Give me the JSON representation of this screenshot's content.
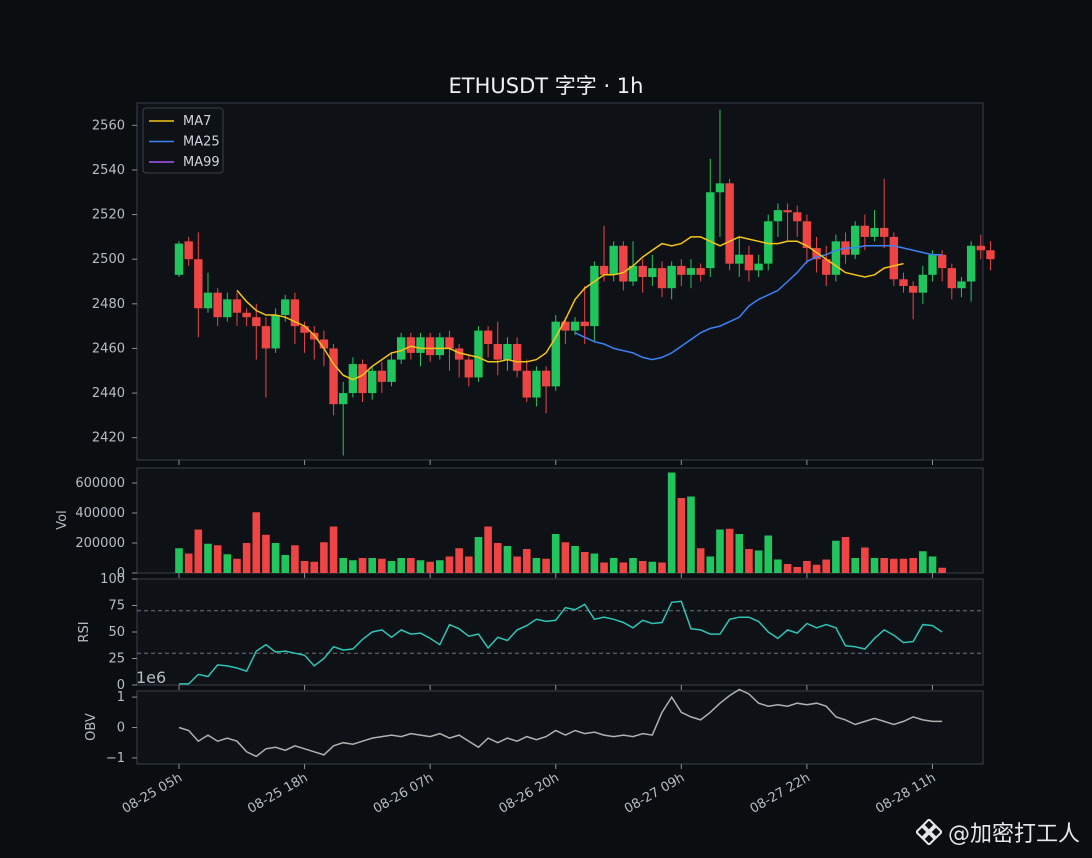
{
  "title": "ETHUSDT 字字 · 1h",
  "watermark": "@加密打工人",
  "colors": {
    "background": "#0b0e11",
    "up": "#21c55d",
    "down": "#ef4444",
    "ma7": "#f5c518",
    "ma25": "#3b82f6",
    "ma99": "#a855f7",
    "rsi": "#2ec4b6",
    "obv": "#b0b0b0"
  },
  "chart_data": [
    {
      "type": "candlestick",
      "title": "ETHUSDT 字字 · 1h",
      "ylim": [
        2410,
        2570
      ],
      "yticks": [
        2420,
        2440,
        2460,
        2480,
        2500,
        2520,
        2540,
        2560
      ],
      "legend": {
        "placement": "top-left",
        "entries": [
          "MA7",
          "MA25",
          "MA99"
        ]
      },
      "x_ticks": [
        "08-25 05h",
        "08-25 18h",
        "08-26 07h",
        "08-26 20h",
        "08-27 09h",
        "08-27 22h",
        "08-28 11h"
      ],
      "ohlc": [
        [
          2493,
          2507,
          2492,
          2508
        ],
        [
          2508,
          2500,
          2497,
          2510
        ],
        [
          2500,
          2478,
          2465,
          2512
        ],
        [
          2478,
          2485,
          2476,
          2494
        ],
        [
          2485,
          2474,
          2470,
          2487
        ],
        [
          2474,
          2482,
          2472,
          2485
        ],
        [
          2482,
          2476,
          2470,
          2485
        ],
        [
          2476,
          2474,
          2470,
          2478
        ],
        [
          2474,
          2470,
          2455,
          2480
        ],
        [
          2470,
          2460,
          2438,
          2474
        ],
        [
          2460,
          2475,
          2458,
          2478
        ],
        [
          2475,
          2482,
          2472,
          2484
        ],
        [
          2482,
          2470,
          2462,
          2485
        ],
        [
          2470,
          2467,
          2458,
          2472
        ],
        [
          2467,
          2464,
          2455,
          2470
        ],
        [
          2464,
          2460,
          2452,
          2468
        ],
        [
          2460,
          2435,
          2430,
          2462
        ],
        [
          2435,
          2440,
          2412,
          2445
        ],
        [
          2440,
          2453,
          2438,
          2456
        ],
        [
          2453,
          2440,
          2436,
          2455
        ],
        [
          2440,
          2450,
          2437,
          2452
        ],
        [
          2450,
          2445,
          2440,
          2454
        ],
        [
          2445,
          2455,
          2443,
          2458
        ],
        [
          2455,
          2465,
          2453,
          2467
        ],
        [
          2465,
          2458,
          2455,
          2467
        ],
        [
          2458,
          2465,
          2452,
          2467
        ],
        [
          2465,
          2457,
          2454,
          2467
        ],
        [
          2457,
          2465,
          2455,
          2467
        ],
        [
          2465,
          2460,
          2450,
          2468
        ],
        [
          2460,
          2455,
          2447,
          2462
        ],
        [
          2455,
          2447,
          2443,
          2457
        ],
        [
          2447,
          2468,
          2445,
          2470
        ],
        [
          2468,
          2462,
          2456,
          2470
        ],
        [
          2462,
          2455,
          2448,
          2472
        ],
        [
          2455,
          2462,
          2450,
          2465
        ],
        [
          2462,
          2450,
          2447,
          2465
        ],
        [
          2450,
          2438,
          2436,
          2455
        ],
        [
          2438,
          2450,
          2434,
          2452
        ],
        [
          2450,
          2443,
          2431,
          2452
        ],
        [
          2443,
          2472,
          2441,
          2475
        ],
        [
          2472,
          2468,
          2462,
          2474
        ],
        [
          2468,
          2472,
          2466,
          2474
        ],
        [
          2472,
          2470,
          2462,
          2488
        ],
        [
          2470,
          2497,
          2463,
          2499
        ],
        [
          2497,
          2493,
          2490,
          2515
        ],
        [
          2493,
          2506,
          2490,
          2508
        ],
        [
          2506,
          2490,
          2486,
          2508
        ],
        [
          2490,
          2497,
          2488,
          2508
        ],
        [
          2497,
          2492,
          2485,
          2500
        ],
        [
          2492,
          2496,
          2488,
          2502
        ],
        [
          2496,
          2487,
          2483,
          2499
        ],
        [
          2487,
          2497,
          2482,
          2499
        ],
        [
          2497,
          2493,
          2488,
          2500
        ],
        [
          2493,
          2496,
          2487,
          2500
        ],
        [
          2496,
          2493,
          2490,
          2498
        ],
        [
          2496,
          2530,
          2492,
          2545
        ],
        [
          2530,
          2534,
          2510,
          2567
        ],
        [
          2534,
          2498,
          2495,
          2536
        ],
        [
          2498,
          2502,
          2492,
          2510
        ],
        [
          2502,
          2495,
          2490,
          2506
        ],
        [
          2495,
          2498,
          2492,
          2502
        ],
        [
          2498,
          2517,
          2495,
          2520
        ],
        [
          2517,
          2522,
          2510,
          2525
        ],
        [
          2522,
          2521,
          2508,
          2525
        ],
        [
          2521,
          2517,
          2510,
          2524
        ],
        [
          2517,
          2505,
          2498,
          2520
        ],
        [
          2505,
          2500,
          2494,
          2510
        ],
        [
          2500,
          2493,
          2488,
          2506
        ],
        [
          2493,
          2508,
          2490,
          2511
        ],
        [
          2508,
          2502,
          2498,
          2512
        ],
        [
          2502,
          2515,
          2500,
          2517
        ],
        [
          2515,
          2510,
          2504,
          2520
        ],
        [
          2510,
          2514,
          2508,
          2522
        ],
        [
          2514,
          2510,
          2505,
          2536
        ],
        [
          2510,
          2491,
          2488,
          2512
        ],
        [
          2491,
          2488,
          2485,
          2494
        ],
        [
          2488,
          2485,
          2473,
          2490
        ],
        [
          2485,
          2493,
          2480,
          2497
        ],
        [
          2493,
          2502,
          2490,
          2504
        ],
        [
          2502,
          2496,
          2490,
          2504
        ],
        [
          2496,
          2487,
          2482,
          2498
        ],
        [
          2487,
          2490,
          2483,
          2492
        ],
        [
          2490,
          2506,
          2481,
          2508
        ],
        [
          2506,
          2504,
          2500,
          2511
        ],
        [
          2504,
          2500,
          2495,
          2508
        ]
      ],
      "ma7": [
        null,
        null,
        null,
        null,
        null,
        null,
        2486,
        2481,
        2477,
        2475,
        2475,
        2474,
        2472,
        2470,
        2466,
        2460,
        2453,
        2448,
        2446,
        2448,
        2452,
        2455,
        2458,
        2459,
        2461,
        2460,
        2460,
        2460,
        2460,
        2458,
        2457,
        2456,
        2454,
        2454,
        2455,
        2454,
        2454,
        2455,
        2458,
        2465,
        2473,
        2482,
        2487,
        2490,
        2493,
        2493,
        2494,
        2497,
        2501,
        2504,
        2507,
        2506,
        2507,
        2510,
        2510,
        2508,
        2506,
        2508,
        2510,
        2509,
        2508,
        2507,
        2507,
        2508,
        2508,
        2506,
        2503,
        2500,
        2497,
        2494,
        2493,
        2492,
        2493,
        2496,
        2497,
        2498
      ],
      "ma25": [
        null,
        null,
        null,
        null,
        null,
        null,
        null,
        null,
        null,
        null,
        null,
        null,
        null,
        null,
        null,
        null,
        null,
        null,
        null,
        null,
        null,
        null,
        null,
        null,
        null,
        null,
        null,
        null,
        null,
        null,
        null,
        null,
        null,
        null,
        null,
        null,
        null,
        null,
        null,
        null,
        null,
        2467,
        2465,
        2463,
        2462,
        2460,
        2459,
        2458,
        2456,
        2455,
        2456,
        2458,
        2461,
        2464,
        2467,
        2469,
        2470,
        2472,
        2474,
        2479,
        2482,
        2484,
        2486,
        2490,
        2494,
        2499,
        2501,
        2502,
        2504,
        2505,
        2505,
        2506,
        2506,
        2506,
        2506,
        2505,
        2504,
        2503,
        2502,
        2502
      ],
      "ma99": []
    },
    {
      "type": "bar",
      "ylabel": "Vol",
      "yticks": [
        0,
        200000,
        400000,
        600000
      ],
      "ylim": [
        0,
        700000
      ],
      "values": [
        165000,
        130000,
        290000,
        195000,
        185000,
        125000,
        95000,
        200000,
        405000,
        255000,
        200000,
        120000,
        185000,
        80000,
        75000,
        205000,
        310000,
        100000,
        85000,
        100000,
        100000,
        95000,
        80000,
        100000,
        100000,
        85000,
        75000,
        85000,
        110000,
        165000,
        110000,
        240000,
        310000,
        200000,
        180000,
        110000,
        160000,
        100000,
        95000,
        260000,
        205000,
        180000,
        140000,
        130000,
        70000,
        100000,
        70000,
        100000,
        80000,
        75000,
        70000,
        670000,
        500000,
        510000,
        165000,
        110000,
        290000,
        295000,
        260000,
        160000,
        150000,
        250000,
        90000,
        60000,
        40000,
        80000,
        55000,
        90000,
        215000,
        240000,
        100000,
        170000,
        100000,
        100000,
        95000,
        95000,
        100000,
        145000,
        110000,
        35000
      ]
    },
    {
      "type": "line",
      "ylabel": "RSI",
      "yticks": [
        0,
        25,
        50,
        75,
        100
      ],
      "ylim": [
        0,
        100
      ],
      "levels": [
        30,
        70
      ],
      "values": [
        1,
        1,
        10,
        8,
        19,
        18,
        16,
        13,
        32,
        38,
        31,
        32,
        30,
        28,
        18,
        25,
        36,
        33,
        34,
        43,
        50,
        52,
        45,
        52,
        48,
        49,
        44,
        38,
        57,
        53,
        46,
        48,
        35,
        45,
        42,
        52,
        56,
        62,
        60,
        61,
        73,
        71,
        76,
        62,
        64,
        62,
        59,
        54,
        61,
        58,
        59,
        78,
        79,
        53,
        52,
        48,
        48,
        62,
        64,
        64,
        60,
        50,
        44,
        52,
        49,
        58,
        54,
        57,
        54,
        37,
        36,
        34,
        44,
        52,
        47,
        40,
        41,
        57,
        56,
        50
      ]
    },
    {
      "type": "line",
      "ylabel": "OBV",
      "multiplier": "1e6",
      "yticks": [
        -1,
        0,
        1
      ],
      "ylim": [
        -1.2,
        1.2
      ],
      "values": [
        0.0,
        -0.1,
        -0.45,
        -0.25,
        -0.45,
        -0.35,
        -0.45,
        -0.8,
        -0.95,
        -0.7,
        -0.65,
        -0.75,
        -0.6,
        -0.7,
        -0.8,
        -0.9,
        -0.6,
        -0.5,
        -0.55,
        -0.45,
        -0.35,
        -0.3,
        -0.25,
        -0.3,
        -0.2,
        -0.25,
        -0.3,
        -0.2,
        -0.35,
        -0.25,
        -0.45,
        -0.65,
        -0.35,
        -0.5,
        -0.35,
        -0.45,
        -0.3,
        -0.4,
        -0.3,
        -0.1,
        -0.25,
        -0.1,
        -0.2,
        -0.15,
        -0.25,
        -0.3,
        -0.25,
        -0.3,
        -0.2,
        -0.25,
        0.5,
        1.0,
        0.5,
        0.35,
        0.25,
        0.5,
        0.8,
        1.05,
        1.25,
        1.1,
        0.8,
        0.7,
        0.75,
        0.7,
        0.8,
        0.75,
        0.8,
        0.7,
        0.35,
        0.25,
        0.1,
        0.2,
        0.3,
        0.2,
        0.1,
        0.2,
        0.35,
        0.25,
        0.2,
        0.2
      ]
    }
  ]
}
